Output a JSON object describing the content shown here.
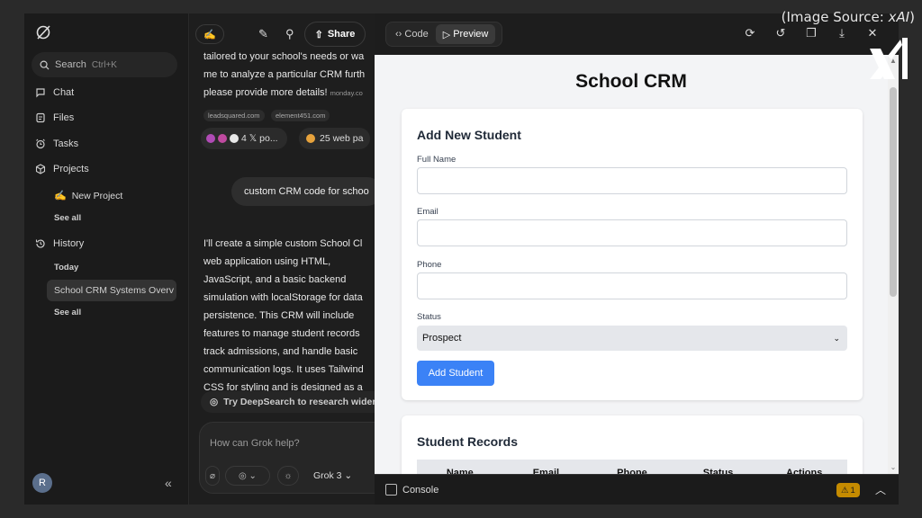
{
  "source_label": "(Image Source: ",
  "source_brand": "xAI",
  "source_close": ")",
  "sidebar": {
    "search_placeholder": "Search",
    "search_shortcut": "Ctrl+K",
    "nav": [
      "Chat",
      "Files",
      "Tasks",
      "Projects"
    ],
    "new_project": "New Project",
    "see_all_projects": "See all",
    "history": "History",
    "today": "Today",
    "history_item": "School CRM Systems Overv",
    "see_all_history": "See all",
    "avatar_initial": "R"
  },
  "chat": {
    "share_label": "Share",
    "intro_lines": [
      "tailored to your school's needs or wa",
      "me to analyze a particular CRM furth",
      "please provide more details!"
    ],
    "intro_source": "monday.co",
    "tags": [
      "leadsquared.com",
      "element451.com"
    ],
    "posts_label": "4 𝕏 po...",
    "web_label": "25 web pa",
    "user_message": "custom CRM code for schoo",
    "response_lines": [
      "I'll create a simple custom School Cl",
      "web application using HTML,",
      "JavaScript, and a basic backend",
      "simulation with localStorage for data",
      "persistence. This CRM will include",
      "features to manage student records",
      "track admissions, and handle basic",
      "communication logs. It uses Tailwind",
      "CSS for styling and is designed as a"
    ],
    "deepsearch_label": "Try DeepSearch to research wider",
    "composer_placeholder": "How can Grok help?",
    "model_label": "Grok 3"
  },
  "panel": {
    "code_tab": "Code",
    "preview_tab": "Preview",
    "app_title": "School CRM",
    "form": {
      "title": "Add New Student",
      "full_name_label": "Full Name",
      "email_label": "Email",
      "phone_label": "Phone",
      "status_label": "Status",
      "status_value": "Prospect",
      "submit_label": "Add Student"
    },
    "records": {
      "title": "Student Records",
      "columns": [
        "Name",
        "Email",
        "Phone",
        "Status",
        "Actions"
      ]
    },
    "console_label": "Console",
    "warning_count": "1"
  }
}
